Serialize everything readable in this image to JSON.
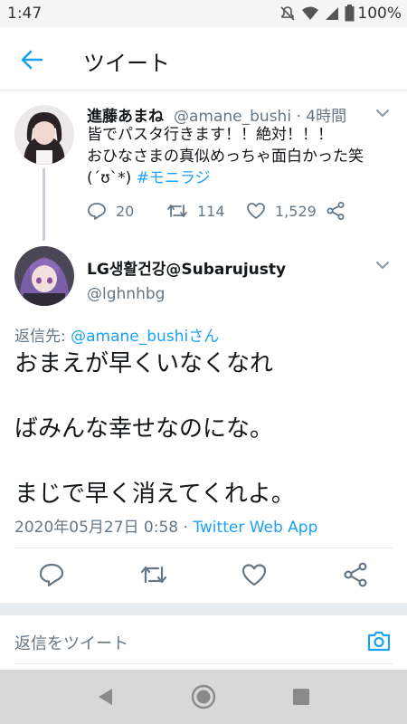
{
  "status_bar": {
    "time": "1:47",
    "battery": "100%",
    "icons": [
      "mute-icon",
      "wifi-icon",
      "signal-icon",
      "battery-icon"
    ]
  },
  "header": {
    "title": "ツイート",
    "back_icon": "back-arrow-icon"
  },
  "parent_tweet": {
    "name": "進藤あまね",
    "handle_time": "@amane_bushi · 4時間",
    "text_line1": "皆でパスタ行きます！！絶対！！！",
    "text_line2": "おひなさまの真似めっちゃ面白かった笑",
    "text_line3_prefix": "(´ʊ`*) ",
    "hashtag": "#モニラジ",
    "replies": "20",
    "retweets": "114",
    "likes": "1,529"
  },
  "reply_tweet": {
    "name": "LG생활건강@Subarujusty",
    "handle": "@lghnhbg",
    "reply_to_label": "返信先: ",
    "reply_to_user": "@amane_bushiさん",
    "body": "おまえが早くいなくなれ\n\nばみんな幸せなのにな。\n\nまじで早く消えてくれよ。",
    "timestamp": "2020年05月27日 0:58 · ",
    "client": "Twitter Web App"
  },
  "composer": {
    "placeholder": "返信をツイート"
  },
  "colors": {
    "accent": "#1da1f2",
    "secondary_text": "#657786",
    "divider": "#e6ecf0",
    "nav_bar": "#d8d8d8"
  }
}
